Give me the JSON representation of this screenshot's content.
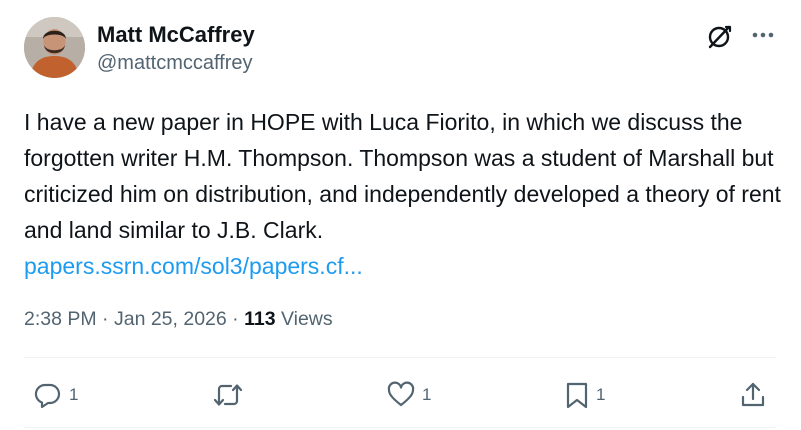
{
  "author": {
    "display_name": "Matt McCaffrey",
    "handle": "@mattcmccaffrey"
  },
  "post": {
    "text": "I have a new paper in HOPE with Luca Fiorito, in which we discuss the forgotten writer H.M. Thompson. Thompson was a student of Marshall but criticized him on distribution, and independently developed a theory of rent and land similar to J.B. Clark.",
    "link": "papers.ssrn.com/sol3/papers.cf..."
  },
  "meta": {
    "time": "2:38 PM",
    "separator": "·",
    "date": "Jan 25, 2026",
    "views_count": "113",
    "views_label": "Views"
  },
  "actions": {
    "reply_count": "1",
    "repost_count": "",
    "like_count": "1",
    "bookmark_count": "1"
  },
  "icons": {
    "grok": "grok-icon",
    "more": "more-icon",
    "reply": "reply-icon",
    "repost": "repost-icon",
    "like": "heart-icon",
    "bookmark": "bookmark-icon",
    "share": "share-icon"
  },
  "colors": {
    "text": "#0f1419",
    "secondary": "#536471",
    "link": "#1d9bf0",
    "divider": "#eff3f4"
  }
}
